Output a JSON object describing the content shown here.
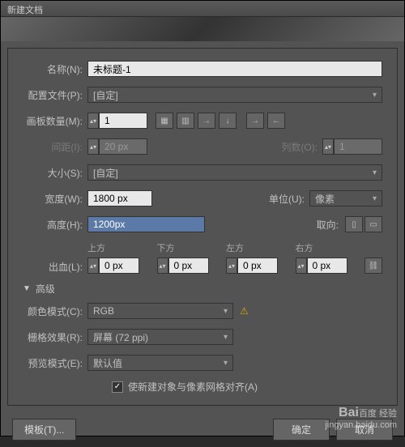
{
  "title": "新建文档",
  "name": {
    "label": "名称(N):",
    "value": "未标题-1"
  },
  "profile": {
    "label": "配置文件(P):",
    "value": "[自定]"
  },
  "artboards": {
    "label": "画板数量(M):",
    "value": "1"
  },
  "spacing": {
    "label": "间距(I):",
    "value": "20 px"
  },
  "columns": {
    "label": "列数(O):",
    "value": "1"
  },
  "size": {
    "label": "大小(S):",
    "value": "[自定]"
  },
  "width": {
    "label": "宽度(W):",
    "value": "1800 px"
  },
  "units": {
    "label": "单位(U):",
    "value": "像素"
  },
  "height": {
    "label": "高度(H):",
    "value": "1200px"
  },
  "orientation": {
    "label": "取向:"
  },
  "bleed": {
    "label": "出血(L):",
    "top": {
      "label": "上方",
      "value": "0 px"
    },
    "bottom": {
      "label": "下方",
      "value": "0 px"
    },
    "left": {
      "label": "左方",
      "value": "0 px"
    },
    "right": {
      "label": "右方",
      "value": "0 px"
    }
  },
  "advanced": {
    "label": "高级",
    "colormode": {
      "label": "颜色模式(C):",
      "value": "RGB"
    },
    "raster": {
      "label": "栅格效果(R):",
      "value": "屏幕 (72 ppi)"
    },
    "preview": {
      "label": "预览模式(E):",
      "value": "默认值"
    },
    "align": "使新建对象与像素网格对齐(A)"
  },
  "buttons": {
    "template": "模板(T)...",
    "ok": "确定",
    "cancel": "取消"
  },
  "watermark": {
    "brand": "Bai",
    "brand2": "百度",
    "brand3": "经验",
    "url": "jingyan.baidu.com"
  }
}
